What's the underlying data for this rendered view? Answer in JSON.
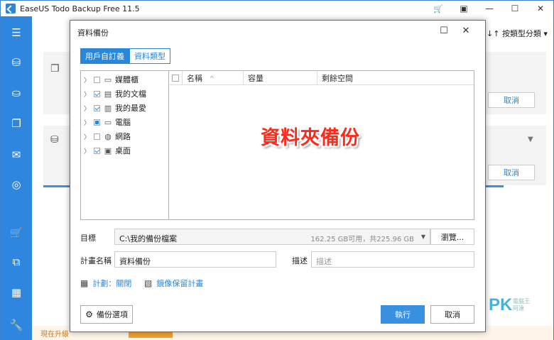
{
  "app": {
    "title": "EaseUS Todo Backup Free 11.5",
    "sort_label": "按類型分類",
    "card_cancel_1": "取消",
    "card_cancel_2": "取消",
    "bottom_text": "現在升級",
    "colors": {
      "accent": "#2a86d6",
      "sidebar": "#2f86de",
      "watermark": "#ff2a1a"
    }
  },
  "sidebar_icons": [
    "menu-icon",
    "disk-backup-icon",
    "system-backup-icon",
    "file-backup-icon",
    "mail-backup-icon",
    "smart-backup-icon",
    "cart-icon",
    "clone-icon",
    "tools-grid-icon",
    "wrench-icon"
  ],
  "dialog": {
    "title": "資料備份",
    "tabs": [
      {
        "label": "用戶自訂義",
        "active": true
      },
      {
        "label": "資料類型",
        "active": false
      }
    ],
    "tree": [
      {
        "label": "媒體櫃",
        "checked": "none",
        "icon": "library-icon"
      },
      {
        "label": "我的文檔",
        "checked": "checked",
        "icon": "document-icon"
      },
      {
        "label": "我的最愛",
        "checked": "checked",
        "icon": "favorites-icon"
      },
      {
        "label": "電腦",
        "checked": "partial",
        "icon": "computer-icon"
      },
      {
        "label": "網路",
        "checked": "none",
        "icon": "network-icon"
      },
      {
        "label": "桌面",
        "checked": "checked",
        "icon": "desktop-icon"
      }
    ],
    "columns": {
      "name": "名稱",
      "capacity": "容量",
      "free": "剩餘空間"
    },
    "watermark": "資料夾備份",
    "target_label": "目標",
    "target_path": "C:\\我的備份檔案",
    "target_space": "162.25 GB可用，共225.96 GB",
    "browse_label": "瀏覽...",
    "plan_name_label": "計畫名稱",
    "plan_name_value": "資料備份",
    "desc_label": "描述",
    "desc_placeholder": "描述",
    "schedule_link": "計劃：關閉",
    "image_reserve_link": "鏡像保留計畫",
    "options_button": "備份選項",
    "execute_button": "執行",
    "cancel_button": "取消"
  },
  "pk_logo": {
    "text": "PK",
    "sub1": "電腦王",
    "sub2": "阿達"
  }
}
